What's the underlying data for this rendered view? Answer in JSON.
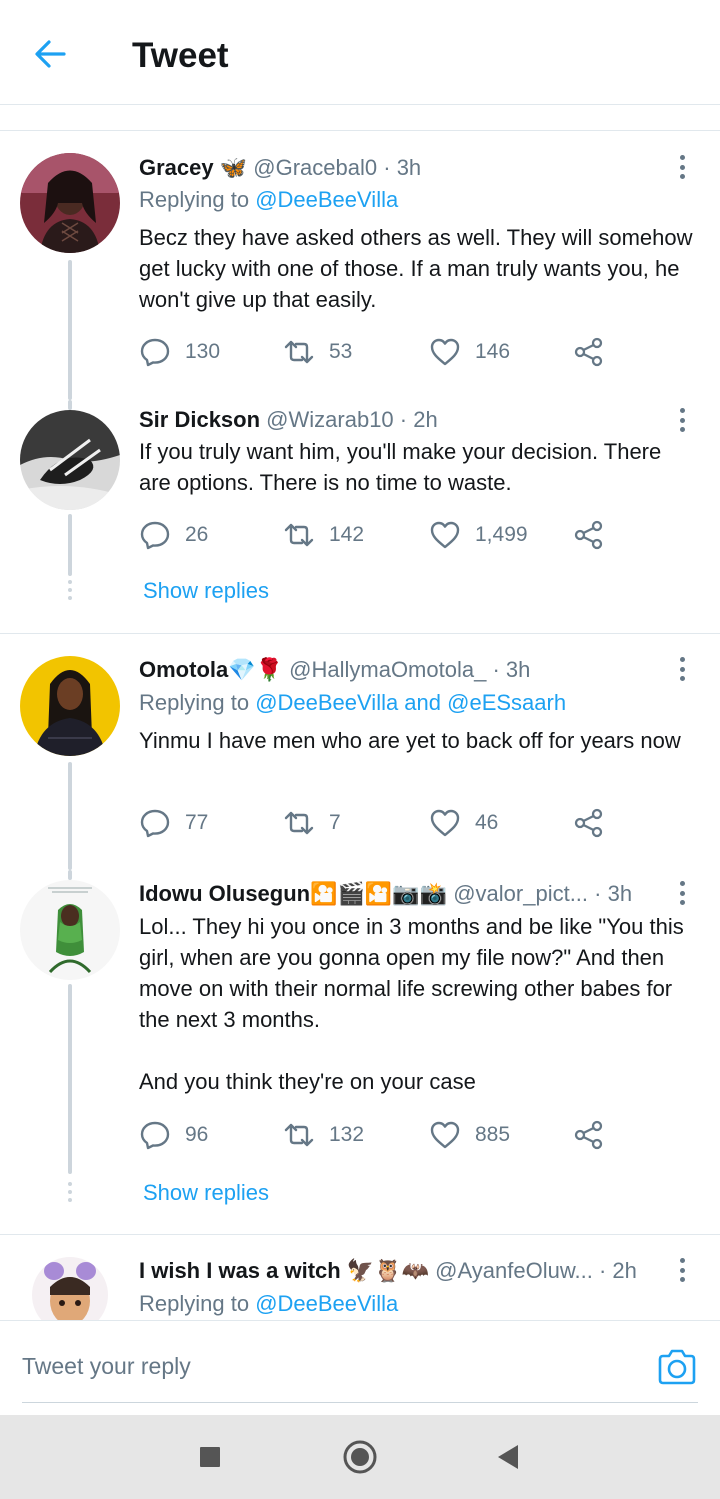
{
  "header": {
    "title": "Tweet"
  },
  "tweets": [
    {
      "name": "Gracey",
      "emoji": "🦋",
      "handle": "@Gracebal0",
      "time": "· 3h",
      "replying_prefix": "Replying to ",
      "replying_to": "@DeeBeeVilla",
      "text": "Becz they have asked others as well. They will somehow get lucky with one of those. If a man truly wants you, he won't give up that easily.",
      "replies": "130",
      "retweets": "53",
      "likes": "146"
    },
    {
      "name": "Sir Dickson",
      "emoji": "",
      "handle": "@Wizarab10",
      "time": "· 2h",
      "text": "If you truly want him, you'll make your decision. There are options. There is no time to waste.",
      "replies": "26",
      "retweets": "142",
      "likes": "1,499",
      "show_replies": "Show replies"
    },
    {
      "name": "Omotola",
      "emoji": "💎🌹",
      "handle": "@HallymaOmotola_",
      "time": "· 3h",
      "replying_prefix": "Replying to ",
      "replying_to": "@DeeBeeVilla and @eESsaarh",
      "text": "Yinmu I have men who are yet to back off for years now",
      "replies": "77",
      "retweets": "7",
      "likes": "46"
    },
    {
      "name": "Idowu Olusegun",
      "emoji": "🎦🎬🎦📷📸",
      "handle": "@valor_pict...",
      "time": "· 3h",
      "text": "Lol... They hi you once in 3 months and be like \"You this girl, when are you gonna open my file now?\" And then move on with their normal life screwing other babes for the next 3 months.\n\nAnd you think they're on your case",
      "replies": "96",
      "retweets": "132",
      "likes": "885",
      "show_replies": "Show replies"
    },
    {
      "name": "I wish I was a witch",
      "emoji": "🦅🦉🦇",
      "handle": "@AyanfeOluw...",
      "time": "· 2h",
      "replying_prefix": "Replying to ",
      "replying_to": "@DeeBeeVilla"
    }
  ],
  "reply_bar": {
    "placeholder": "Tweet your reply"
  },
  "icons": {
    "back": "arrow-left-icon",
    "reply": "speech-bubble-icon",
    "retweet": "retweet-icon",
    "like": "heart-icon",
    "share": "share-icon",
    "more": "more-vertical-icon",
    "camera": "camera-icon"
  },
  "colors": {
    "accent": "#1da1f2",
    "muted": "#657786",
    "text": "#14171a"
  }
}
